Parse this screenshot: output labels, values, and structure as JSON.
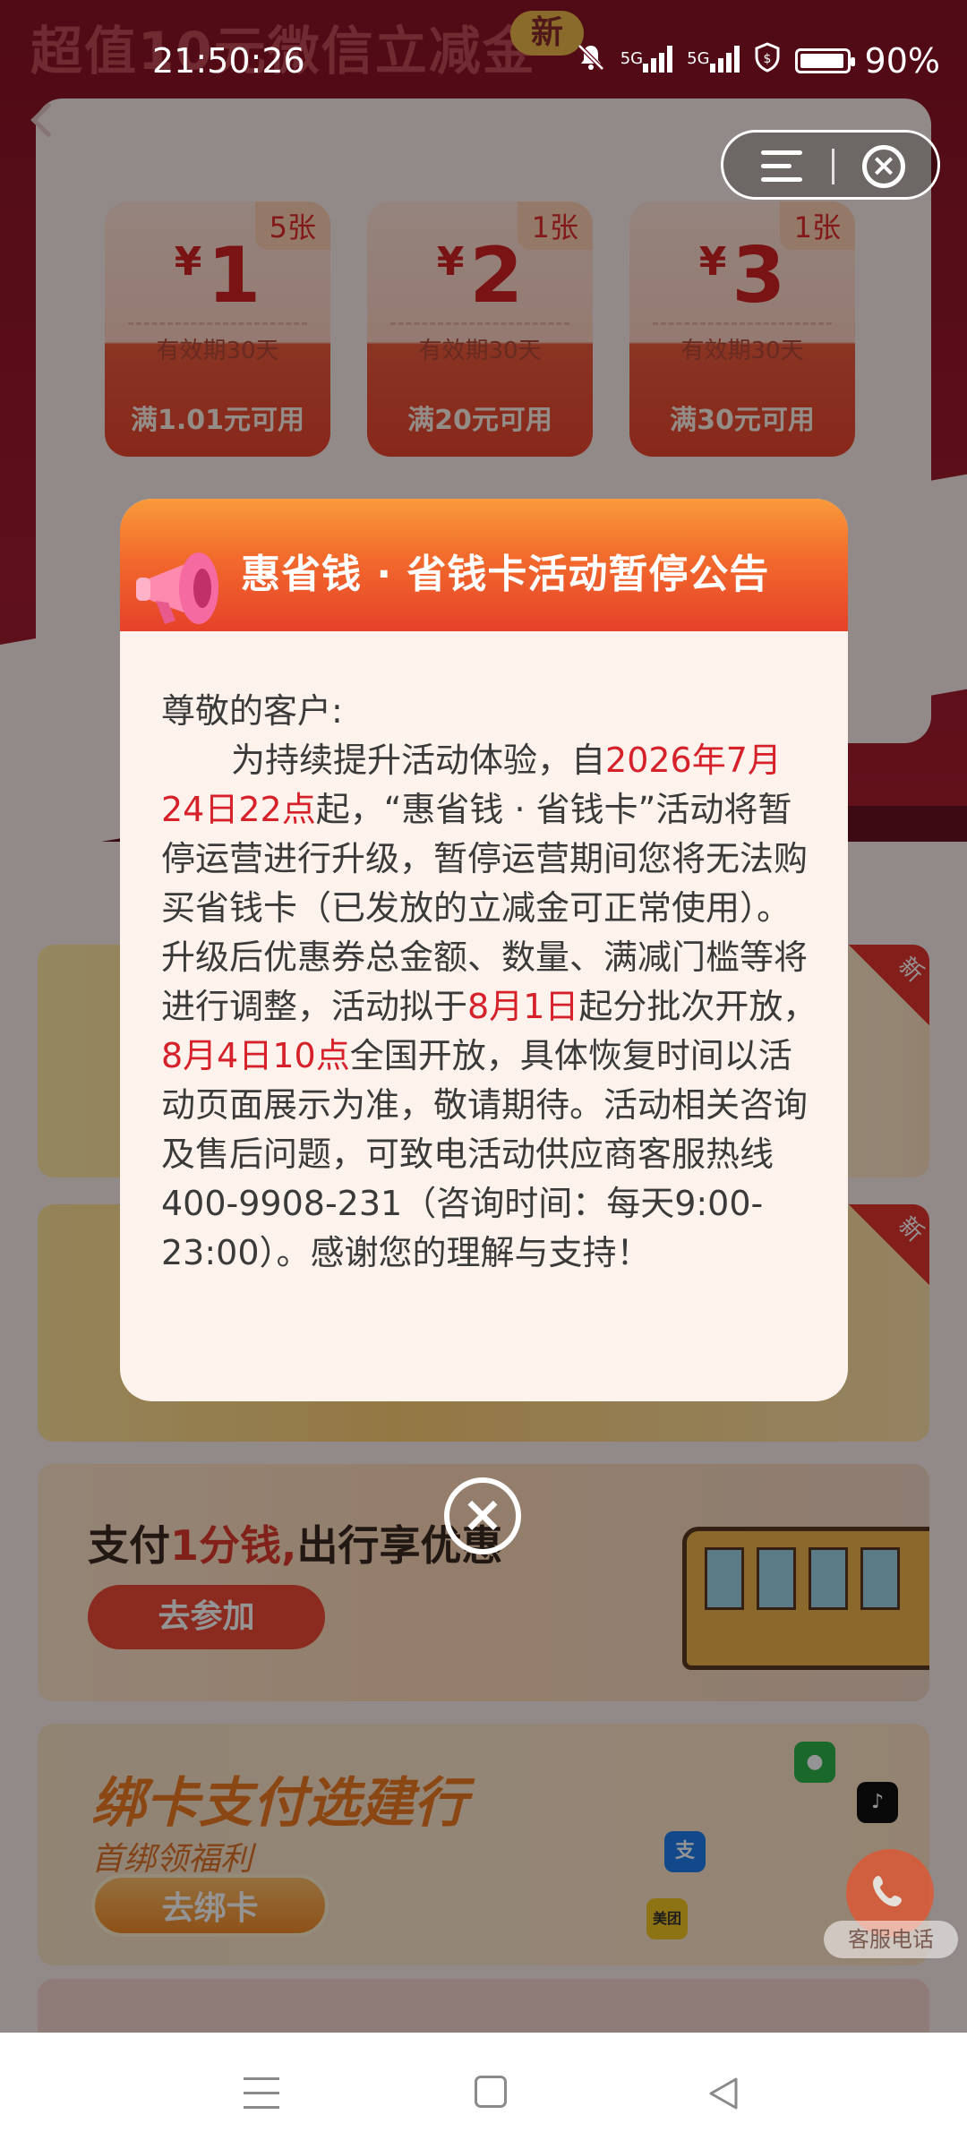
{
  "status_bar": {
    "time": "21:50:26",
    "network_1": "5G",
    "network_2": "5G",
    "battery": "90%"
  },
  "hero": {
    "title": "超值10元微信立减金",
    "badge": "新"
  },
  "coupons": [
    {
      "qty": "5张",
      "yen": "¥",
      "amount": "1",
      "validity": "有效期30天",
      "condition": "满1.01元可用"
    },
    {
      "qty": "1张",
      "yen": "¥",
      "amount": "2",
      "validity": "有效期30天",
      "condition": "满20元可用"
    },
    {
      "qty": "1张",
      "yen": "¥",
      "amount": "3",
      "validity": "有效期30天",
      "condition": "满30元可用"
    }
  ],
  "promos": {
    "new_tag": "新",
    "transit": {
      "title_prefix": "支付",
      "title_highlight": "1分钱,",
      "title_suffix": "出行享优惠",
      "button": "去参加"
    },
    "bank": {
      "title": "绑卡支付选建行",
      "subtitle": "首绑领福利",
      "button": "去绑卡",
      "chip_alipay": "支",
      "chip_meituan": "美团"
    }
  },
  "customer_service": {
    "label": "客服电话"
  },
  "modal": {
    "title": "惠省钱 · 省钱卡活动暂停公告",
    "greeting": "尊敬的客户:",
    "p1": "为持续提升活动体验，自",
    "h1": "2026年7月24日22点",
    "p2": "起，“惠省钱 · 省钱卡”活动将暂停运营进行升级，暂停运营期间您将无法购买省钱卡（已发放的立减金可正常使用）。升级后优惠券总金额、数量、满减门槛等将进行调整，活动拟于",
    "h2": "8月1日",
    "p3": "起分批次开放，",
    "h3": "8月4日10点",
    "p4": "全国开放，具体恢复时间以活动页面展示为准，敬请期待。活动相关咨询及售后问题，可致电活动供应商客服热线400-9908-231（咨询时间：每天9:00-23:00）。感谢您的理解与支持！"
  },
  "colors": {
    "accent_red": "#d6202a",
    "header_orange": "#f26a2c",
    "modal_bg": "#fdf3ec"
  }
}
